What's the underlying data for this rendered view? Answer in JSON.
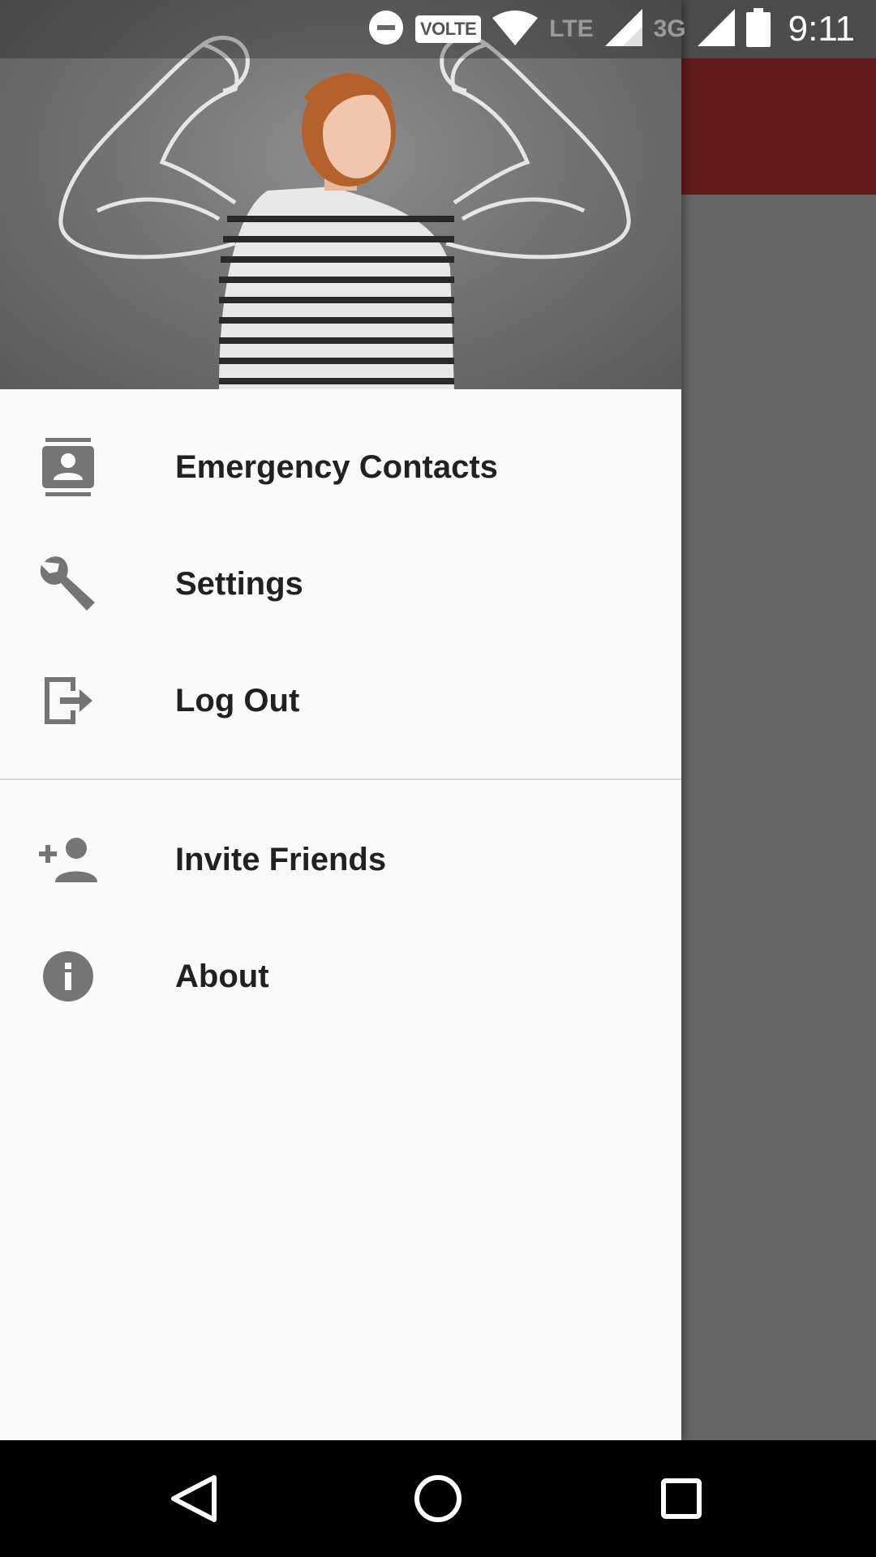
{
  "status_bar": {
    "time": "9:11",
    "volte": "VOLTE",
    "lte": "LTE",
    "network_3g": "3G",
    "icons": [
      "do-not-disturb-icon",
      "wifi-icon",
      "signal-icon",
      "battery-icon"
    ]
  },
  "drawer": {
    "header_image": "woman-with-drawn-muscles-image",
    "items": [
      {
        "label": "Emergency Contacts",
        "icon": "contacts-icon"
      },
      {
        "label": "Settings",
        "icon": "wrench-icon"
      },
      {
        "label": "Log Out",
        "icon": "logout-icon"
      },
      {
        "label": "Invite Friends",
        "icon": "person-add-icon"
      },
      {
        "label": "About",
        "icon": "info-icon"
      }
    ]
  },
  "colors": {
    "app_bar": "#631b1b",
    "drawer_bg": "#fafafa",
    "icon": "#757575",
    "text": "#212121"
  },
  "nav_bar": {
    "buttons": [
      "back-icon",
      "home-icon",
      "recents-icon"
    ]
  }
}
